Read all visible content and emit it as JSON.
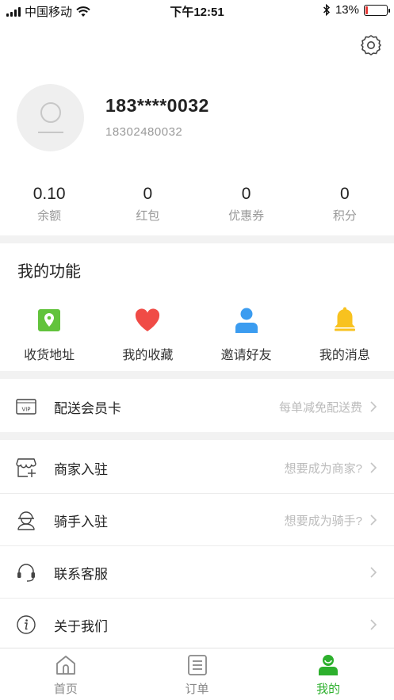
{
  "status_bar": {
    "carrier": "中国移动",
    "time": "下午12:51",
    "battery_percent": "13%",
    "battery_level": 0.13
  },
  "profile": {
    "nickname": "183****0032",
    "phone": "18302480032"
  },
  "stats": [
    {
      "value": "0.10",
      "label": "余额"
    },
    {
      "value": "0",
      "label": "红包"
    },
    {
      "value": "0",
      "label": "优惠券"
    },
    {
      "value": "0",
      "label": "积分"
    }
  ],
  "functions": {
    "title": "我的功能",
    "items": [
      {
        "label": "收货地址",
        "icon": "location-icon"
      },
      {
        "label": "我的收藏",
        "icon": "heart-icon"
      },
      {
        "label": "邀请好友",
        "icon": "person-icon"
      },
      {
        "label": "我的消息",
        "icon": "bell-icon"
      }
    ]
  },
  "rows": {
    "vip": {
      "label": "配送会员卡",
      "hint": "每单减免配送费"
    },
    "merchant": {
      "label": "商家入驻",
      "hint": "想要成为商家?"
    },
    "rider": {
      "label": "骑手入驻",
      "hint": "想要成为骑手?"
    },
    "service": {
      "label": "联系客服"
    },
    "about": {
      "label": "关于我们"
    }
  },
  "vip_badge": "VIP",
  "tabbar": [
    {
      "label": "首页",
      "active": false
    },
    {
      "label": "订单",
      "active": false
    },
    {
      "label": "我的",
      "active": true
    }
  ],
  "colors": {
    "accent_green": "#2db02d",
    "heart_red": "#f04b46",
    "person_blue": "#3b9cf0",
    "bell_yellow": "#f8c21f",
    "location_green": "#62c33c"
  }
}
